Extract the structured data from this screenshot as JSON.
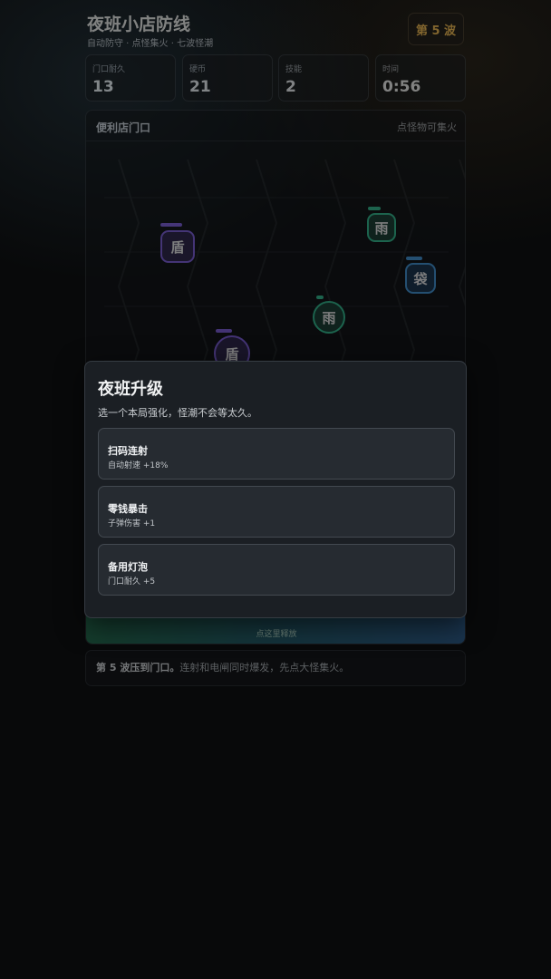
{
  "header": {
    "title": "夜班小店防线",
    "subtitle": "自动防守 · 点怪集火 · 七波怪潮",
    "wave_badge": "第 5 波"
  },
  "stats": [
    {
      "label": "门口耐久",
      "value": "13"
    },
    {
      "label": "硬币",
      "value": "21"
    },
    {
      "label": "技能",
      "value": "2"
    },
    {
      "label": "时间",
      "value": "0:56"
    }
  ],
  "arena": {
    "title": "便利店门口",
    "hint": "点怪物可集火",
    "enemies": [
      {
        "glyph": "盾",
        "color": "#7a5bd6"
      },
      {
        "glyph": "雨",
        "color": "#2fb58a"
      },
      {
        "glyph": "袋",
        "color": "#3f8fd0"
      },
      {
        "glyph": "雨",
        "color": "#2fb58a"
      },
      {
        "glyph": "盾",
        "color": "#7a5bd6"
      }
    ],
    "fire_button_label": "点这里释放"
  },
  "tip": {
    "bold": "第 5 波压到门口。",
    "text": "连射和电闸同时爆发，先点大怪集火。"
  },
  "upgrade_modal": {
    "title": "夜班升级",
    "subtitle": "选一个本局强化，怪潮不会等太久。",
    "choices": [
      {
        "name": "扫码连射",
        "desc": "自动射速 +18%"
      },
      {
        "name": "零钱暴击",
        "desc": "子弹伤害 +1"
      },
      {
        "name": "备用灯泡",
        "desc": "门口耐久 +5"
      }
    ]
  },
  "colors": {
    "accent_gold": "#e7b24c",
    "shield_enemy": "#7a5bd6",
    "rain_enemy": "#2fb58a",
    "bag_enemy": "#3f8fd0"
  }
}
